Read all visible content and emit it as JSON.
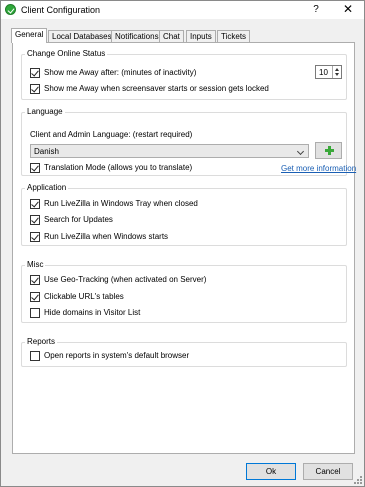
{
  "window": {
    "title": "Client Configuration",
    "help": "?",
    "close": "✕"
  },
  "tabs": [
    "General",
    "Local Databases",
    "Notifications",
    "Chat",
    "Inputs",
    "Tickets"
  ],
  "online_status": {
    "title": "Change Online Status",
    "away_after": {
      "label": "Show me Away after: (minutes of inactivity)",
      "checked": true,
      "minutes": "10"
    },
    "away_screensaver": {
      "label": "Show me Away when screensaver starts or session gets locked",
      "checked": true
    }
  },
  "language": {
    "title": "Language",
    "label": "Client and Admin Language: (restart required)",
    "selected": "Danish",
    "translation_mode": {
      "label": "Translation Mode (allows you to translate)",
      "checked": true
    },
    "more_info_link": "Get more information"
  },
  "application": {
    "title": "Application",
    "items": [
      {
        "label": "Run LiveZilla in Windows Tray when closed",
        "checked": true
      },
      {
        "label": "Search for Updates",
        "checked": true
      },
      {
        "label": "Run LiveZilla when Windows starts",
        "checked": true
      }
    ]
  },
  "misc": {
    "title": "Misc",
    "items": [
      {
        "label": "Use Geo-Tracking (when activated on Server)",
        "checked": true
      },
      {
        "label": "Clickable URL's tables",
        "checked": true
      },
      {
        "label": "Hide domains in Visitor List",
        "checked": false
      }
    ]
  },
  "reports": {
    "title": "Reports",
    "items": [
      {
        "label": "Open reports in system's default browser",
        "checked": false
      }
    ]
  },
  "buttons": {
    "ok": "Ok",
    "cancel": "Cancel"
  }
}
